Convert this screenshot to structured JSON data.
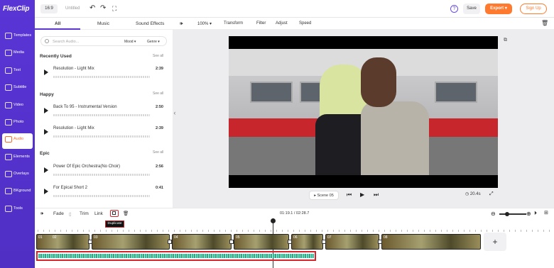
{
  "app": {
    "logo": "FlexClip"
  },
  "topbar": {
    "ratio": "16:9",
    "title": "Untitled",
    "help": "?",
    "save": "Save",
    "export": "Export",
    "signup": "Sign Up"
  },
  "sidebar": {
    "items": [
      {
        "label": "Templates"
      },
      {
        "label": "Media"
      },
      {
        "label": "Text"
      },
      {
        "label": "Subtitle"
      },
      {
        "label": "Video"
      },
      {
        "label": "Photo"
      },
      {
        "label": "Audio",
        "active": true
      },
      {
        "label": "Elements"
      },
      {
        "label": "Overlays"
      },
      {
        "label": "BKground"
      },
      {
        "label": "Tools"
      }
    ]
  },
  "panel": {
    "tabs": [
      "All",
      "Music",
      "Sound Effects"
    ],
    "search_placeholder": "Search Audio...",
    "filter_mood": "Mood",
    "filter_genre": "Genre",
    "sections": [
      {
        "title": "Recently Used",
        "see_all": "See all",
        "tracks": [
          {
            "name": "Resolution - Light Mix",
            "duration": "2:39"
          }
        ]
      },
      {
        "title": "Happy",
        "see_all": "See all",
        "tracks": [
          {
            "name": "Back To 95 - Instrumental Version",
            "duration": "2:50"
          },
          {
            "name": "Resolution - Light Mix",
            "duration": "2:39"
          }
        ]
      },
      {
        "title": "Epic",
        "see_all": "See all",
        "tracks": [
          {
            "name": "Power Of Epic Orchestra(No Choir)",
            "duration": "2:56"
          },
          {
            "name": "For Epical Short 2",
            "duration": "0:41"
          }
        ]
      }
    ]
  },
  "preview": {
    "toolbar": {
      "zoom": "100%",
      "transform": "Transform",
      "filter": "Filter",
      "adjust": "Adjust",
      "speed": "Speed"
    },
    "scene": "Scene 05",
    "scene_duration": "20.4s"
  },
  "timeline": {
    "fade": "Fade",
    "trim": "Trim",
    "link": "Link",
    "tooltip": "Duplicate",
    "time": "01:19.1 / 02:28.7",
    "zoom_level": 0.25,
    "clips": [
      "01",
      "02",
      "03",
      "04",
      "05",
      "06",
      "07",
      "08"
    ]
  },
  "colors": {
    "brand": "#5a35d6",
    "accent": "#ff7a2f",
    "highlight": "#d4262a",
    "audio_wave": "#3ab89a"
  }
}
